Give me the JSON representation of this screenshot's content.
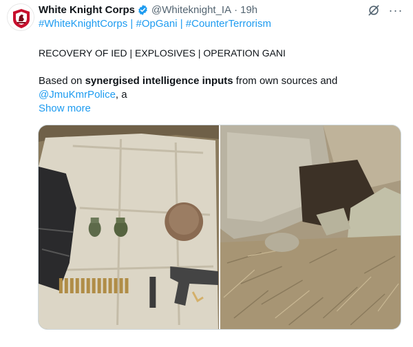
{
  "author": {
    "display_name": "White Knight Corps",
    "handle": "@Whiteknight_IA",
    "separator": "·",
    "time": "19h",
    "verified": true,
    "avatar_icon": "white-knight-corps-emblem"
  },
  "actions": {
    "grok_icon": "grok-icon",
    "more_label": "···"
  },
  "hashtags": [
    "#WhiteKnightCorps",
    "#OpGani",
    "#CounterTerrorism"
  ],
  "hashtag_separator": "|",
  "post": {
    "headline": "RECOVERY OF IED | EXPLOSIVES | OPERATION GANI",
    "body_prefix": "Based on ",
    "body_bold": "synergised intelligence inputs",
    "body_suffix": " from own sources and",
    "mention": "@JmuKmrPolice",
    "mention_suffix": ", a",
    "show_more": "Show more"
  },
  "media": [
    {
      "name": "recovered-items-photo"
    },
    {
      "name": "hideout-rocks-photo"
    }
  ],
  "colors": {
    "link": "#1d9bf0",
    "text": "#0f1419",
    "secondary": "#536471",
    "verified": "#1d9bf0"
  }
}
